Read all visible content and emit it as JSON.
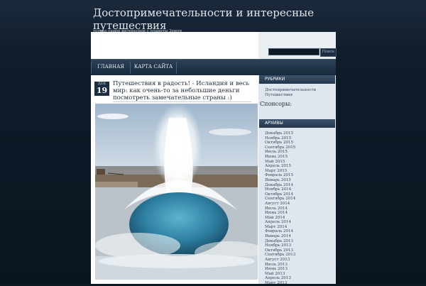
{
  "site": {
    "title": "Достопримечательности и интересные путешествия",
    "tagline": "только самое интересное с планеты Земля"
  },
  "search": {
    "placeholder": "",
    "button_label": "Поиск"
  },
  "nav": {
    "items": [
      "ГЛАВНАЯ",
      "КАРТА САЙТА"
    ]
  },
  "post": {
    "date_month": "ДЕК",
    "date_day": "19",
    "title": "Путешествия в радость! - Исландия и весь мир: как очень-то за небольшие деньги посмотреть замечательные страны :)",
    "image": "geyser-photo"
  },
  "sidebar": {
    "categories_heading": "РУБРИКИ",
    "categories": [
      "Достопримечательности",
      "Путешествия"
    ],
    "sponsors_label": "Спонсоры:",
    "archives_heading": "АРХИВЫ",
    "archives": [
      "Декабрь 2015",
      "Ноябрь 2015",
      "Октябрь 2015",
      "Сентябрь 2015",
      "Июль 2015",
      "Июнь 2015",
      "Май 2015",
      "Апрель 2015",
      "Март 2015",
      "Февраль 2015",
      "Январь 2015",
      "Декабрь 2014",
      "Ноябрь 2014",
      "Октябрь 2014",
      "Сентябрь 2014",
      "Август 2014",
      "Июль 2014",
      "Июнь 2014",
      "Май 2014",
      "Апрель 2014",
      "Март 2014",
      "Февраль 2014",
      "Январь 2014",
      "Декабрь 2013",
      "Ноябрь 2013",
      "Октябрь 2013",
      "Сентябрь 2013",
      "Август 2013",
      "Июль 2013",
      "Июнь 2013",
      "Май 2013",
      "Апрель 2013",
      "Март 2013"
    ]
  },
  "colors": {
    "header_dark": "#0d1a26",
    "nav": "#22364b",
    "accent": "#1b2d40"
  }
}
